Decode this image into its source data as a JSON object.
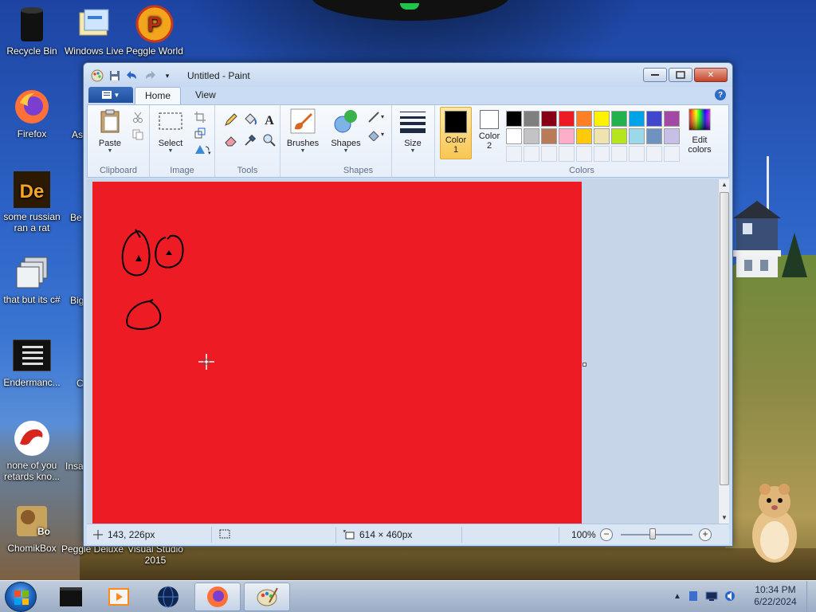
{
  "desktop": {
    "icons": [
      {
        "label": "Recycle Bin",
        "icon": "recycle-bin-icon"
      },
      {
        "label": "Windows Live",
        "icon": "windows-live-icon"
      },
      {
        "label": "Peggle World",
        "icon": "peggle-icon"
      },
      {
        "label": "Firefox",
        "icon": "firefox-icon"
      },
      {
        "label": "some russian ran a rat",
        "icon": "de-app-icon"
      },
      {
        "label": "that but its c#",
        "icon": "stacked-windows-icon"
      },
      {
        "label": "Endermanc...",
        "icon": "terminal-icon"
      },
      {
        "label": "none of you retards kno...",
        "icon": "red-dragon-icon"
      },
      {
        "label": "ChomikBox",
        "icon": "hamster-box-icon"
      },
      {
        "label": "Peggle Deluxe",
        "icon": "peggle-deluxe-icon"
      },
      {
        "label": "Visual Studio 2015",
        "icon": "visual-studio-icon"
      }
    ],
    "partial_labels": [
      "As",
      "Be",
      "Big",
      "C",
      "Insa"
    ]
  },
  "window": {
    "title": "Untitled - Paint",
    "tabs": [
      "Home",
      "View"
    ],
    "ribbon": {
      "groups": {
        "clipboard": {
          "label": "Clipboard",
          "paste": "Paste"
        },
        "image": {
          "label": "Image",
          "select": "Select"
        },
        "tools": {
          "label": "Tools"
        },
        "shapes": {
          "label": "Shapes",
          "brushes": "Brushes",
          "shapes_btn": "Shapes"
        },
        "size": {
          "label": "Size"
        },
        "colors": {
          "label": "Colors",
          "color1": "Color\n1",
          "color1_line1": "Color",
          "color1_line2": "1",
          "color2_line1": "Color",
          "color2_line2": "2",
          "edit_colors_line1": "Edit",
          "edit_colors_line2": "colors",
          "color1_value": "#000000",
          "color2_value": "#ffffff",
          "palette_row1": [
            "#000000",
            "#7f7f7f",
            "#880015",
            "#ed1c24",
            "#ff7f27",
            "#fff200",
            "#22b14c",
            "#00a2e8",
            "#3f48cc",
            "#a349a4"
          ],
          "palette_row2": [
            "#ffffff",
            "#c3c3c3",
            "#b97a57",
            "#ffaec9",
            "#ffc90e",
            "#efe4b0",
            "#b5e61d",
            "#99d9ea",
            "#7092be",
            "#c8bfe7"
          ]
        }
      }
    },
    "canvas": {
      "fill_color": "#ed1c24"
    },
    "status": {
      "cursor_pos": "143, 226px",
      "canvas_size": "614 × 460px",
      "zoom": "100%"
    }
  },
  "taskbar": {
    "time": "10:34 PM",
    "date": "6/22/2024"
  }
}
